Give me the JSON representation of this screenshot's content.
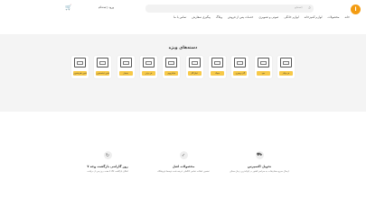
{
  "header": {
    "logo_text": "ا",
    "search_placeholder": "جستجو",
    "login_label": "ورود | ثبت‌نام",
    "nav": [
      "خانه",
      "محصولات",
      "لوازم آشپزخانه",
      "لوازم خانگی",
      "صوتی و تصویری",
      "خدمات پس از فروش",
      "وبلاگ",
      "پیگیری سفارش",
      "تماس با ما"
    ]
  },
  "special_categories": {
    "title": "دسته‌های ویژه",
    "items": [
      {
        "label": "فر توکار"
      },
      {
        "label": "هود"
      },
      {
        "label": "گاز رومیزی"
      },
      {
        "label": "سینک"
      },
      {
        "label": "اجاق گاز"
      },
      {
        "label": "مایکروویو"
      },
      {
        "label": "فر برقی"
      },
      {
        "label": "یخچال"
      },
      {
        "label": "ماشین لباسشویی"
      },
      {
        "label": "ماشین ظرفشویی"
      }
    ]
  },
  "features": [
    {
      "title": "تحویل اکسپرس",
      "desc": "ارسال سریع سفارشات به سراسر کشور در کوتاه‌ترین زمان ممکن",
      "icon": "truck-icon"
    },
    {
      "title": "محصولات اصل",
      "desc": "تضمین اصالت تمامی کالاهای عرضه شده توسط فروشگاه",
      "icon": "shield-icon"
    },
    {
      "title": "۷ روز گارانتی بازگشت وجه",
      "desc": "امکان بازگشت کالا تا هفت روز پس از دریافت",
      "icon": "refresh-icon"
    }
  ]
}
